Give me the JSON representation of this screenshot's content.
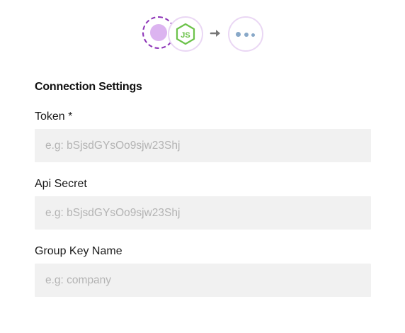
{
  "flow": {
    "trigger_icon": "dashed-circle-icon",
    "app_icon": "nodejs-icon",
    "app_icon_text": "JS",
    "connector_icon": "arrow-right-icon",
    "next_icon": "more-dots-icon",
    "colors": {
      "dashed_border": "#8e35b8",
      "trigger_fill": "#dcb4f0",
      "node_border": "#ead7f4",
      "nodejs_green": "#6cc24a",
      "arrow": "#777777",
      "dots": "#88a8c8"
    }
  },
  "form": {
    "section_title": "Connection Settings",
    "fields": [
      {
        "label": "Token *",
        "value": "",
        "placeholder": "e.g: bSjsdGYsOo9sjw23Shj"
      },
      {
        "label": "Api Secret",
        "value": "",
        "placeholder": "e.g: bSjsdGYsOo9sjw23Shj"
      },
      {
        "label": "Group Key Name",
        "value": "",
        "placeholder": "e.g: company"
      }
    ],
    "input_background": "#f1f1f1",
    "placeholder_color": "#b3b3b3"
  }
}
